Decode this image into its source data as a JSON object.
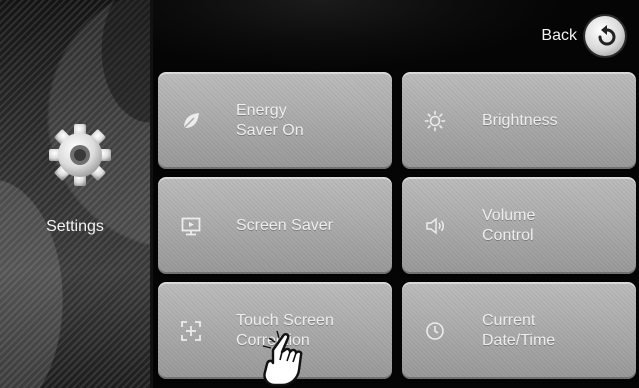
{
  "sidebar": {
    "title": "Settings",
    "icon": "gear-icon"
  },
  "header": {
    "back_label": "Back",
    "back_icon": "undo-arrow-icon"
  },
  "tiles": [
    {
      "label": "Energy\nSaver On",
      "icon": "leaf-icon"
    },
    {
      "label": "Brightness",
      "icon": "sun-icon"
    },
    {
      "label": "Screen Saver",
      "icon": "monitor-icon"
    },
    {
      "label": "Volume\nControl",
      "icon": "speaker-icon"
    },
    {
      "label": "Touch Screen\nCorrection",
      "icon": "crosshair-icon"
    },
    {
      "label": "Current\nDate/Time",
      "icon": "clock-icon"
    }
  ],
  "pointer": {
    "icon": "pointing-hand-icon"
  },
  "colors": {
    "background": "#0e0e0e",
    "tile": "#b0b0b0",
    "text": "#ededed"
  }
}
